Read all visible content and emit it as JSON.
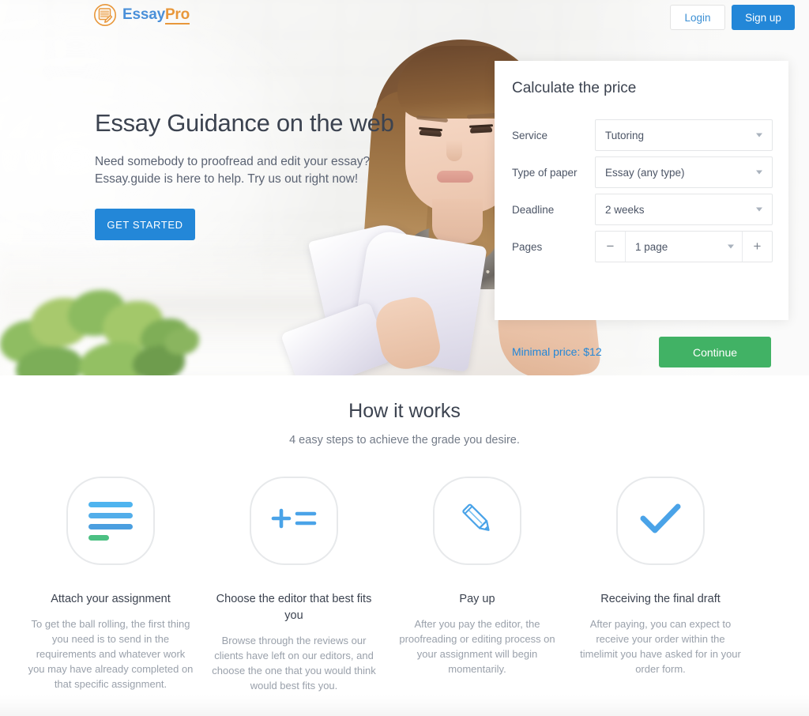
{
  "brand": {
    "name_part1": "Essay",
    "name_part2": "Pro",
    "logo_icon": "notepad-pencil-icon",
    "color_blue": "#4a90d9",
    "color_orange": "#e8973a"
  },
  "topbar": {
    "login_label": "Login",
    "signup_label": "Sign up"
  },
  "hero": {
    "title": "Essay Guidance on the web",
    "subtitle_line1": "Need somebody to proofread and edit your essay?",
    "subtitle_line2": "Essay.guide is here to help. Try us out right now!",
    "cta_label": "GET STARTED"
  },
  "calculator": {
    "title": "Calculate the price",
    "fields": [
      {
        "label": "Service",
        "value": "Tutoring",
        "icon": "chevron-down-icon"
      },
      {
        "label": "Type of paper",
        "value": "Essay (any type)",
        "icon": "chevron-down-icon"
      },
      {
        "label": "Deadline",
        "value": "2 weeks",
        "icon": "chevron-down-icon"
      }
    ],
    "pages": {
      "label": "Pages",
      "value": "1 page",
      "decrement_label": "−",
      "increment_label": "+",
      "icon": "chevron-down-icon"
    },
    "minimal_price": "Minimal price: $12",
    "continue_label": "Continue",
    "continue_color": "#41b265",
    "price_color": "#2387d8"
  },
  "how_it_works": {
    "title": "How it works",
    "subtitle": "4 easy steps to achieve the grade you desire.",
    "steps": [
      {
        "icon": "list-lines-icon",
        "heading": "Attach your assignment",
        "text": "To get the ball rolling, the first thing you need is to send in the requirements and whatever work you may have already completed on that specific assignment."
      },
      {
        "icon": "plus-equals-icon",
        "heading": "Choose the editor that best fits you",
        "text": "Browse through the reviews our clients have left on our editors, and choose the one that you would think would best fits you."
      },
      {
        "icon": "pencil-icon",
        "heading": "Pay up",
        "text": "After you pay the editor, the proofreading or editing process on your assignment will begin momentarily."
      },
      {
        "icon": "check-icon",
        "heading": "Receiving the final draft",
        "text": "After paying, you can expect to receive your order within the timelimit you have asked for in your order form."
      }
    ]
  },
  "colors": {
    "primary_blue": "#2387d8",
    "icon_blue": "#4aa3e8",
    "icon_green": "#4cc083",
    "text_dark": "#3c4350",
    "text_muted": "#9aa1ab"
  }
}
